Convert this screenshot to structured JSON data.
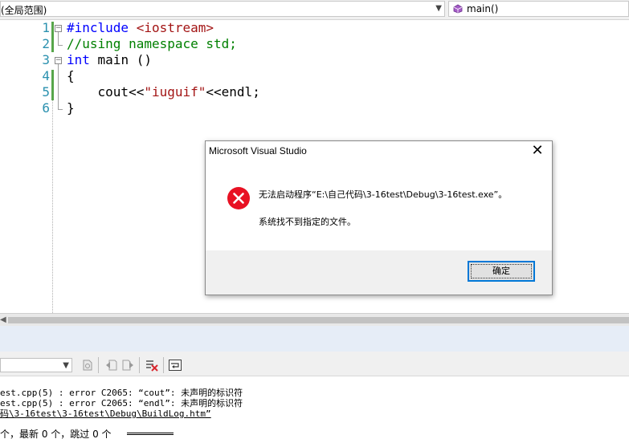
{
  "navbar": {
    "scope": "(全局范围)",
    "function": "main()"
  },
  "editor": {
    "line_numbers": [
      "1",
      "2",
      "3",
      "4",
      "5",
      "6"
    ],
    "lines": [
      {
        "keyword": "#include",
        "rest": " ",
        "string": "<iostream>"
      },
      {
        "comment": "//using namespace std;"
      },
      {
        "keyword": "int",
        "rest": " main ()"
      },
      {
        "text": "{"
      },
      {
        "pre": "    cout<<",
        "string": "\"iuguif\"",
        "post": "<<endl;"
      },
      {
        "text": "}"
      }
    ]
  },
  "dialog": {
    "title": "Microsoft Visual Studio",
    "close": "✕",
    "message": "无法启动程序“E:\\自己代码\\3-16test\\Debug\\3-16test.exe”。",
    "detail": "系统找不到指定的文件。",
    "ok": "确定"
  },
  "output": {
    "lines": [
      "est.cpp(5) : error C2065: “cout”: 未声明的标识符",
      "est.cpp(5) : error C2065: “endl”: 未声明的标识符",
      "码\\3-16test\\3-16test\\Debug\\BuildLog.htm”",
      "个，最新 0 个，跳过 0 个"
    ]
  },
  "colors": {
    "keyword": "#0000ff",
    "string": "#a31515",
    "comment": "#008000",
    "line_number": "#2b91af",
    "error_icon": "#e81123",
    "focus_border": "#0078d7"
  }
}
